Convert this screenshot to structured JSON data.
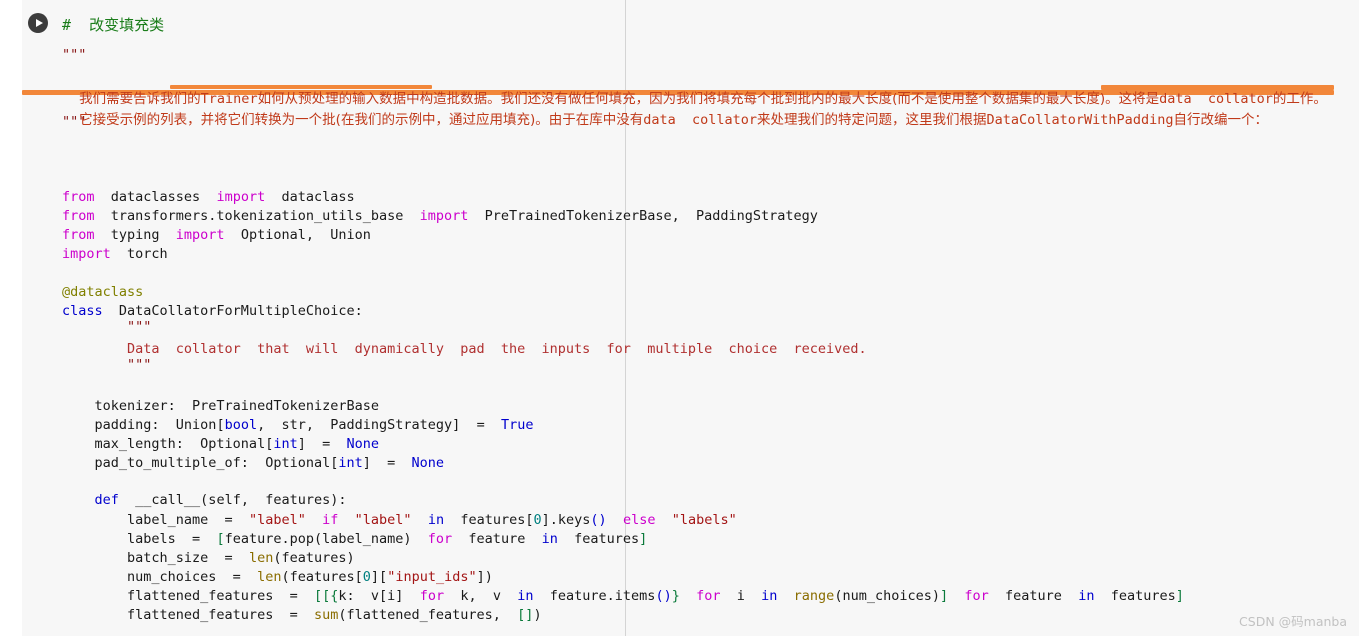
{
  "notebook": {
    "run_button_icon": "play-icon",
    "header_comment": "#  改变填充类",
    "docstring_open": "\"\"\"",
    "docstring_close": "\"\"\"",
    "prose": {
      "line1_a": "我们需要告诉我们的",
      "line1_mono1": "Trainer",
      "line1_b": "如何从预处理的输入数据中构造批数据。我们还没有做任何填充，因为我们将填充每个批到批内的最大长度(而不是使用整个数据集的最大长度)。这将是",
      "line1_mono2": "data  collator",
      "line1_c": "的工作。",
      "line2_a": "它接受示例的列表，并将它们转换为一个批(在我们的示例中，通过应用填充)。由于在库中没有",
      "line2_mono1": "data  collator",
      "line2_b": "来处理我们的特定问题，这里我们根据",
      "line2_mono2": "DataCollatorWithPadding",
      "line2_c": "自行改编一个："
    },
    "highlight_color": "#f2873a",
    "code_lines": [
      {
        "id": "import1",
        "tokens": [
          {
            "t": "from",
            "c": "kw"
          },
          {
            "t": "  dataclasses  ",
            "c": "plain"
          },
          {
            "t": "import",
            "c": "kw"
          },
          {
            "t": "  dataclass",
            "c": "plain"
          }
        ]
      },
      {
        "id": "import2",
        "tokens": [
          {
            "t": "from",
            "c": "kw"
          },
          {
            "t": "  transformers.tokenization_utils_base  ",
            "c": "plain"
          },
          {
            "t": "import",
            "c": "kw"
          },
          {
            "t": "  PreTrainedTokenizerBase,  PaddingStrategy",
            "c": "plain"
          }
        ]
      },
      {
        "id": "import3",
        "tokens": [
          {
            "t": "from",
            "c": "kw"
          },
          {
            "t": "  typing  ",
            "c": "plain"
          },
          {
            "t": "import",
            "c": "kw"
          },
          {
            "t": "  Optional,  Union",
            "c": "plain"
          }
        ]
      },
      {
        "id": "import4",
        "tokens": [
          {
            "t": "import",
            "c": "kw"
          },
          {
            "t": "  torch",
            "c": "plain"
          }
        ]
      },
      {
        "id": "decorator",
        "tokens": [
          {
            "t": "@dataclass",
            "c": "deco"
          }
        ]
      },
      {
        "id": "classdef",
        "tokens": [
          {
            "t": "class",
            "c": "kw2"
          },
          {
            "t": "  DataCollatorForMultipleChoice:",
            "c": "plain"
          }
        ]
      },
      {
        "id": "docopen",
        "tokens": [
          {
            "t": "        \"\"\"",
            "c": "dsq"
          }
        ]
      },
      {
        "id": "docbody",
        "tokens": [
          {
            "t": "        Data  collator  that  will  dynamically  pad  the  inputs  for  multiple  choice  received.",
            "c": "dsb"
          }
        ]
      },
      {
        "id": "docclose",
        "tokens": [
          {
            "t": "        \"\"\"",
            "c": "dsq"
          }
        ]
      },
      {
        "id": "field1",
        "tokens": [
          {
            "t": "    tokenizer:  PreTrainedTokenizerBase",
            "c": "plain"
          }
        ]
      },
      {
        "id": "field2",
        "tokens": [
          {
            "t": "    padding:  Union",
            "c": "plain"
          },
          {
            "t": "[",
            "c": "plain"
          },
          {
            "t": "bool",
            "c": "kw2"
          },
          {
            "t": ",  str,  PaddingStrategy",
            "c": "plain"
          },
          {
            "t": "]",
            "c": "plain"
          },
          {
            "t": "  =  ",
            "c": "plain"
          },
          {
            "t": "True",
            "c": "kw2"
          }
        ]
      },
      {
        "id": "field3",
        "tokens": [
          {
            "t": "    max_length:  Optional",
            "c": "plain"
          },
          {
            "t": "[",
            "c": "plain"
          },
          {
            "t": "int",
            "c": "kw2"
          },
          {
            "t": "]",
            "c": "plain"
          },
          {
            "t": "  =  ",
            "c": "plain"
          },
          {
            "t": "None",
            "c": "kw2"
          }
        ]
      },
      {
        "id": "field4",
        "tokens": [
          {
            "t": "    pad_to_multiple_of:  Optional",
            "c": "plain"
          },
          {
            "t": "[",
            "c": "plain"
          },
          {
            "t": "int",
            "c": "kw2"
          },
          {
            "t": "]",
            "c": "plain"
          },
          {
            "t": "  =  ",
            "c": "plain"
          },
          {
            "t": "None",
            "c": "kw2"
          }
        ]
      },
      {
        "id": "defcall",
        "tokens": [
          {
            "t": "    ",
            "c": "plain"
          },
          {
            "t": "def",
            "c": "kw2"
          },
          {
            "t": "  __call__(self,  features):",
            "c": "plain"
          }
        ]
      },
      {
        "id": "body1",
        "tokens": [
          {
            "t": "        label_name  =  ",
            "c": "plain"
          },
          {
            "t": "\"label\"",
            "c": "str"
          },
          {
            "t": "  ",
            "c": "plain"
          },
          {
            "t": "if",
            "c": "kw"
          },
          {
            "t": "  ",
            "c": "plain"
          },
          {
            "t": "\"label\"",
            "c": "str"
          },
          {
            "t": "  ",
            "c": "plain"
          },
          {
            "t": "in",
            "c": "kw2"
          },
          {
            "t": "  features",
            "c": "plain"
          },
          {
            "t": "[",
            "c": "plain"
          },
          {
            "t": "0",
            "c": "num"
          },
          {
            "t": "]",
            "c": "plain"
          },
          {
            "t": ".keys",
            "c": "plain"
          },
          {
            "t": "()",
            "c": "kw2"
          },
          {
            "t": "  ",
            "c": "plain"
          },
          {
            "t": "else",
            "c": "kw"
          },
          {
            "t": "  ",
            "c": "plain"
          },
          {
            "t": "\"labels\"",
            "c": "str"
          }
        ]
      },
      {
        "id": "body2",
        "tokens": [
          {
            "t": "        labels  =  ",
            "c": "plain"
          },
          {
            "t": "[",
            "c": "brk"
          },
          {
            "t": "feature.pop(label_name)  ",
            "c": "plain"
          },
          {
            "t": "for",
            "c": "kw"
          },
          {
            "t": "  feature  ",
            "c": "plain"
          },
          {
            "t": "in",
            "c": "kw2"
          },
          {
            "t": "  features",
            "c": "plain"
          },
          {
            "t": "]",
            "c": "brk"
          }
        ]
      },
      {
        "id": "body3",
        "tokens": [
          {
            "t": "        batch_size  =  ",
            "c": "plain"
          },
          {
            "t": "len",
            "c": "builtin"
          },
          {
            "t": "(features)",
            "c": "plain"
          }
        ]
      },
      {
        "id": "body4",
        "tokens": [
          {
            "t": "        num_choices  =  ",
            "c": "plain"
          },
          {
            "t": "len",
            "c": "builtin"
          },
          {
            "t": "(features",
            "c": "plain"
          },
          {
            "t": "[",
            "c": "plain"
          },
          {
            "t": "0",
            "c": "num"
          },
          {
            "t": "]",
            "c": "plain"
          },
          {
            "t": "[",
            "c": "plain"
          },
          {
            "t": "\"input_ids\"",
            "c": "str"
          },
          {
            "t": "]",
            "c": "plain"
          },
          {
            "t": ")",
            "c": "plain"
          }
        ]
      },
      {
        "id": "body5",
        "tokens": [
          {
            "t": "        flattened_features  =  ",
            "c": "plain"
          },
          {
            "t": "[[",
            "c": "brk"
          },
          {
            "t": "{",
            "c": "brk"
          },
          {
            "t": "k:  v",
            "c": "plain"
          },
          {
            "t": "[",
            "c": "plain"
          },
          {
            "t": "i",
            "c": "plain"
          },
          {
            "t": "]",
            "c": "plain"
          },
          {
            "t": "  ",
            "c": "plain"
          },
          {
            "t": "for",
            "c": "kw"
          },
          {
            "t": "  k,  v  ",
            "c": "plain"
          },
          {
            "t": "in",
            "c": "kw2"
          },
          {
            "t": "  feature.items",
            "c": "plain"
          },
          {
            "t": "()",
            "c": "kw2"
          },
          {
            "t": "}",
            "c": "brk"
          },
          {
            "t": "  ",
            "c": "plain"
          },
          {
            "t": "for",
            "c": "kw"
          },
          {
            "t": "  i  ",
            "c": "plain"
          },
          {
            "t": "in",
            "c": "kw2"
          },
          {
            "t": "  ",
            "c": "plain"
          },
          {
            "t": "range",
            "c": "builtin"
          },
          {
            "t": "(num_choices)",
            "c": "plain"
          },
          {
            "t": "]",
            "c": "brk"
          },
          {
            "t": "  ",
            "c": "plain"
          },
          {
            "t": "for",
            "c": "kw"
          },
          {
            "t": "  feature  ",
            "c": "plain"
          },
          {
            "t": "in",
            "c": "kw2"
          },
          {
            "t": "  features",
            "c": "plain"
          },
          {
            "t": "]",
            "c": "brk"
          }
        ]
      },
      {
        "id": "body6",
        "tokens": [
          {
            "t": "        flattened_features  =  ",
            "c": "plain"
          },
          {
            "t": "sum",
            "c": "builtin"
          },
          {
            "t": "(flattened_features,  ",
            "c": "plain"
          },
          {
            "t": "[]",
            "c": "brk"
          },
          {
            "t": ")",
            "c": "plain"
          }
        ]
      }
    ]
  },
  "watermark": "CSDN @码manba"
}
